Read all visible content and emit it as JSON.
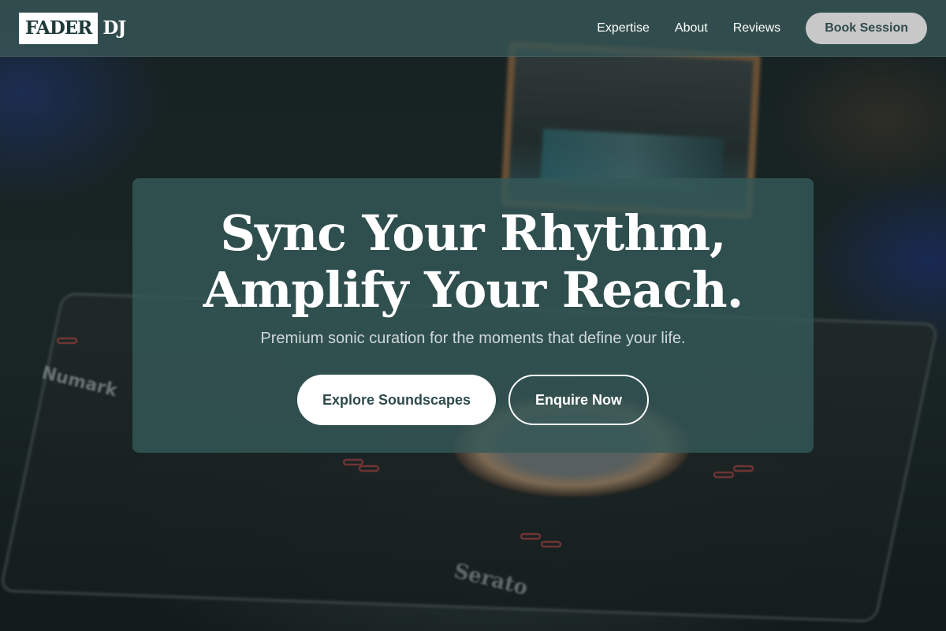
{
  "nav": {
    "logo_box": "FADER",
    "logo_rest": "DJ",
    "links": [
      "Expertise",
      "About",
      "Reviews"
    ],
    "cta": "Book Session"
  },
  "hero": {
    "title_line1": "Sync Your Rhythm,",
    "title_line2": "Amplify Your Reach.",
    "subtitle": "Premium sonic curation for the moments that define your life.",
    "primary_button": "Explore Soundscapes",
    "secondary_button": "Enquire Now"
  },
  "background": {
    "brand_print": "Numark",
    "software_print": "Serato"
  }
}
